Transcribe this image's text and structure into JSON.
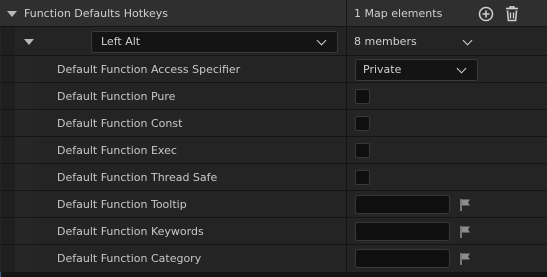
{
  "header": {
    "title": "Function Defaults Hotkeys",
    "value": "1 Map elements",
    "add_icon": "add-circle-icon",
    "delete_icon": "trash-icon"
  },
  "map_entry": {
    "key_icon": "keyboard-icon",
    "key_value": "Left Alt",
    "members": "8 members"
  },
  "properties": [
    {
      "label": "Default Function Access Specifier",
      "type": "dropdown",
      "value": "Private"
    },
    {
      "label": "Default Function Pure",
      "type": "checkbox",
      "checked": false
    },
    {
      "label": "Default Function Const",
      "type": "checkbox",
      "checked": false
    },
    {
      "label": "Default Function Exec",
      "type": "checkbox",
      "checked": false
    },
    {
      "label": "Default Function Thread Safe",
      "type": "checkbox",
      "checked": false
    },
    {
      "label": "Default Function Tooltip",
      "type": "text",
      "value": "",
      "flag_icon": "flag-icon"
    },
    {
      "label": "Default Function Keywords",
      "type": "text",
      "value": "",
      "flag_icon": "flag-icon"
    },
    {
      "label": "Default Function Category",
      "type": "text",
      "value": "",
      "flag_icon": "flag-icon"
    }
  ]
}
